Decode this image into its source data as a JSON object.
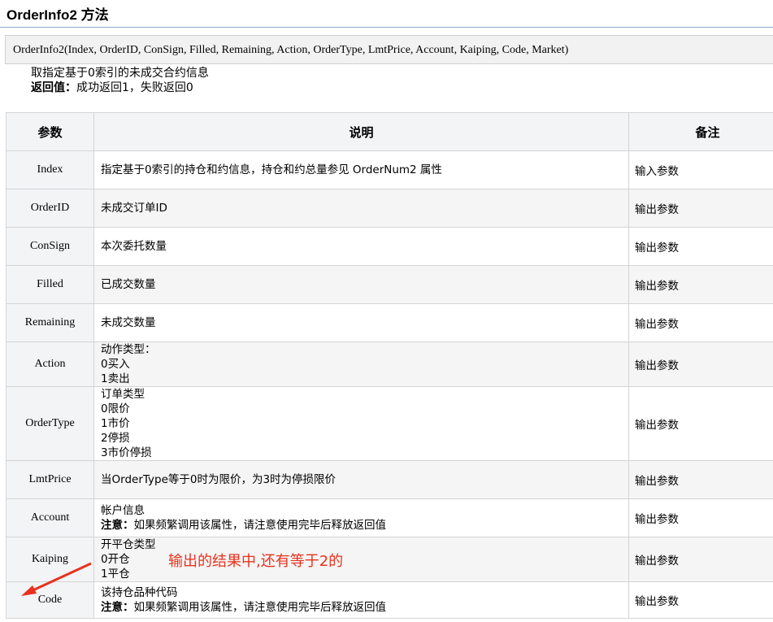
{
  "header": {
    "title": "OrderInfo2 方法"
  },
  "signature": "OrderInfo2(Index, OrderID, ConSign, Filled, Remaining, Action, OrderType, LmtPrice, Account, Kaiping, Code, Market)",
  "description": {
    "summary": "取指定基于0索引的未成交合约信息",
    "return_label": "返回值：",
    "return_text": "成功返回1，失败返回0"
  },
  "table": {
    "headers": [
      "参数",
      "说明",
      "备注"
    ],
    "rows": [
      {
        "param": "Index",
        "lines": [
          "指定基于0索引的持仓和约信息，持仓和约总量参见 OrderNum2 属性"
        ],
        "note": "输入参数"
      },
      {
        "param": "OrderID",
        "lines": [
          "未成交订单ID"
        ],
        "note": "输出参数"
      },
      {
        "param": "ConSign",
        "lines": [
          "本次委托数量"
        ],
        "note": "输出参数"
      },
      {
        "param": "Filled",
        "lines": [
          "已成交数量"
        ],
        "note": "输出参数"
      },
      {
        "param": "Remaining",
        "lines": [
          "未成交数量"
        ],
        "note": "输出参数"
      },
      {
        "param": "Action",
        "lines": [
          "动作类型：",
          "0买入",
          "1卖出"
        ],
        "note": "输出参数"
      },
      {
        "param": "OrderType",
        "lines": [
          "订单类型",
          "0限价",
          "1市价",
          "2停损",
          "3市价停损"
        ],
        "note": "输出参数"
      },
      {
        "param": "LmtPrice",
        "lines": [
          "当OrderType等于0时为限价，为3时为停损限价"
        ],
        "note": "输出参数"
      },
      {
        "param": "Account",
        "lines": [
          "帐户信息"
        ],
        "warn_label": "注意：",
        "warn_text": "如果频繁调用该属性，请注意使用完毕后释放返回值",
        "note": "输出参数"
      },
      {
        "param": "Kaiping",
        "lines": [
          "开平仓类型",
          "0开仓",
          "1平仓"
        ],
        "note": "输出参数"
      },
      {
        "param": "Code",
        "lines": [
          "该持仓品种代码"
        ],
        "warn_label": "注意：",
        "warn_text": "如果频繁调用该属性，请注意使用完毕后释放返回值",
        "note": "输出参数"
      }
    ]
  },
  "annotation": {
    "text": "输出的结果中,还有等于2的",
    "color": "#e8321e"
  }
}
